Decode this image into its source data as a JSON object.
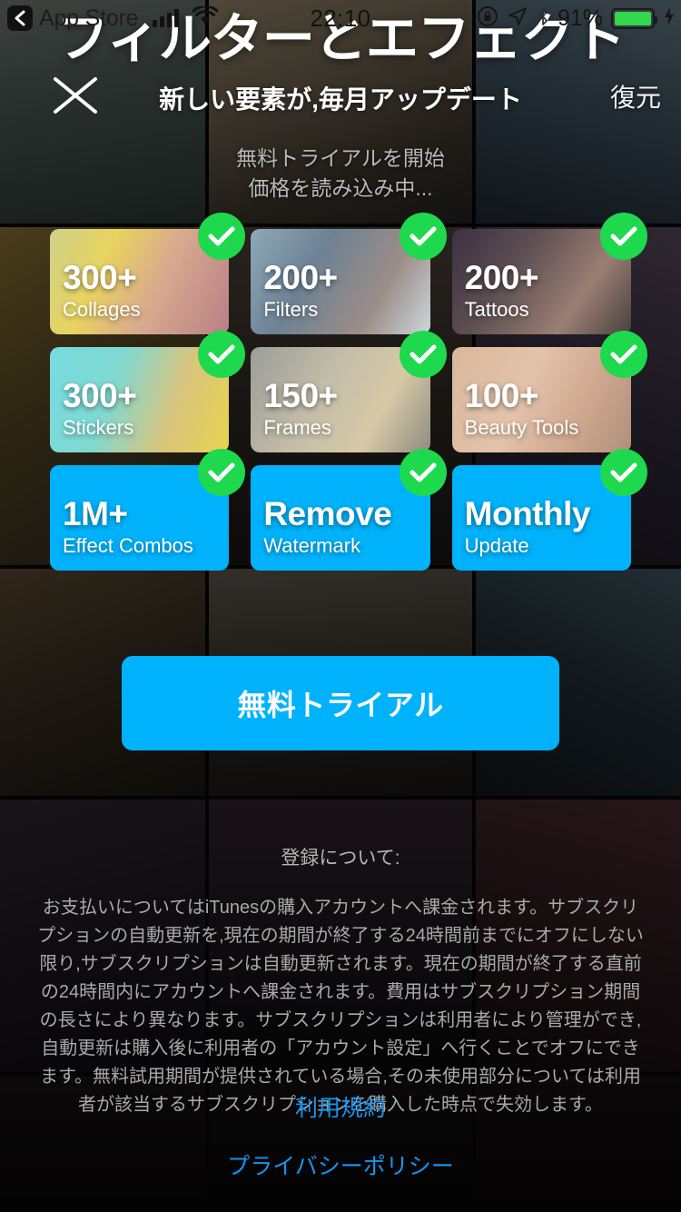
{
  "statusbar": {
    "back_label": "App Store",
    "time": "22:10",
    "battery_percent": "91%",
    "icons": [
      "back-chevron-icon",
      "signal-bars-icon",
      "wifi-icon",
      "rotation-lock-icon",
      "location-arrow-icon",
      "bluetooth-icon",
      "battery-icon",
      "charging-bolt-icon"
    ]
  },
  "header": {
    "title": "フィルターとエフェクト",
    "subtitle": "新しい要素が,毎月アップデート",
    "close_label": "✕",
    "restore_label": "復元"
  },
  "price": {
    "line1": "無料トライアルを開始",
    "line2": "価格を読み込み中..."
  },
  "features": {
    "rows": [
      [
        {
          "big": "300+",
          "small": "Collages",
          "style": "photo",
          "photo": "collage-photo"
        },
        {
          "big": "200+",
          "small": "Filters",
          "style": "photo",
          "photo": "portrait-photo"
        },
        {
          "big": "200+",
          "small": "Tattoos",
          "style": "photo",
          "photo": "tattoo-photo"
        }
      ],
      [
        {
          "big": "300+",
          "small": "Stickers",
          "style": "photo",
          "photo": "stickers-photo"
        },
        {
          "big": "150+",
          "small": "Frames",
          "style": "photo",
          "photo": "frames-photo"
        },
        {
          "big": "100+",
          "small": "Beauty Tools",
          "style": "photo",
          "photo": "beauty-photo"
        }
      ],
      [
        {
          "big": "1M+",
          "small": "Effect Combos",
          "style": "solid",
          "photo": ""
        },
        {
          "big": "Remove",
          "small": "Watermark",
          "style": "solid",
          "photo": ""
        },
        {
          "big": "Monthly",
          "small": "Update",
          "style": "solid",
          "photo": ""
        }
      ]
    ],
    "badge_icon": "check-icon"
  },
  "cta": {
    "label": "無料トライアル"
  },
  "legal": {
    "heading": "登録について:",
    "paragraph": "お支払いについてはiTunesの購入アカウントへ課金されます。サブスクリプションの自動更新を,現在の期間が終了する24時間前までにオフにしない限り,サブスクリプションは自動更新されます。現在の期間が終了する直前の24時間内にアカウントへ課金されます。費用はサブスクリプション期間の長さにより異なります。サブスクリプションは利用者により管理ができ,自動更新は購入後に利用者の「アカウント設定」へ行くことでオフにできます。無料試用期間が提供されている場合,その未使用部分については利用者が該当するサブスクリプションを購入した時点で失効します。"
  },
  "links": {
    "terms": "利用規約",
    "privacy": "プライバシーポリシー"
  },
  "colors": {
    "accent_blue": "#00b2fb",
    "check_green": "#1ed94e",
    "link_blue": "#1395ef",
    "battery_green": "#32d74b"
  }
}
